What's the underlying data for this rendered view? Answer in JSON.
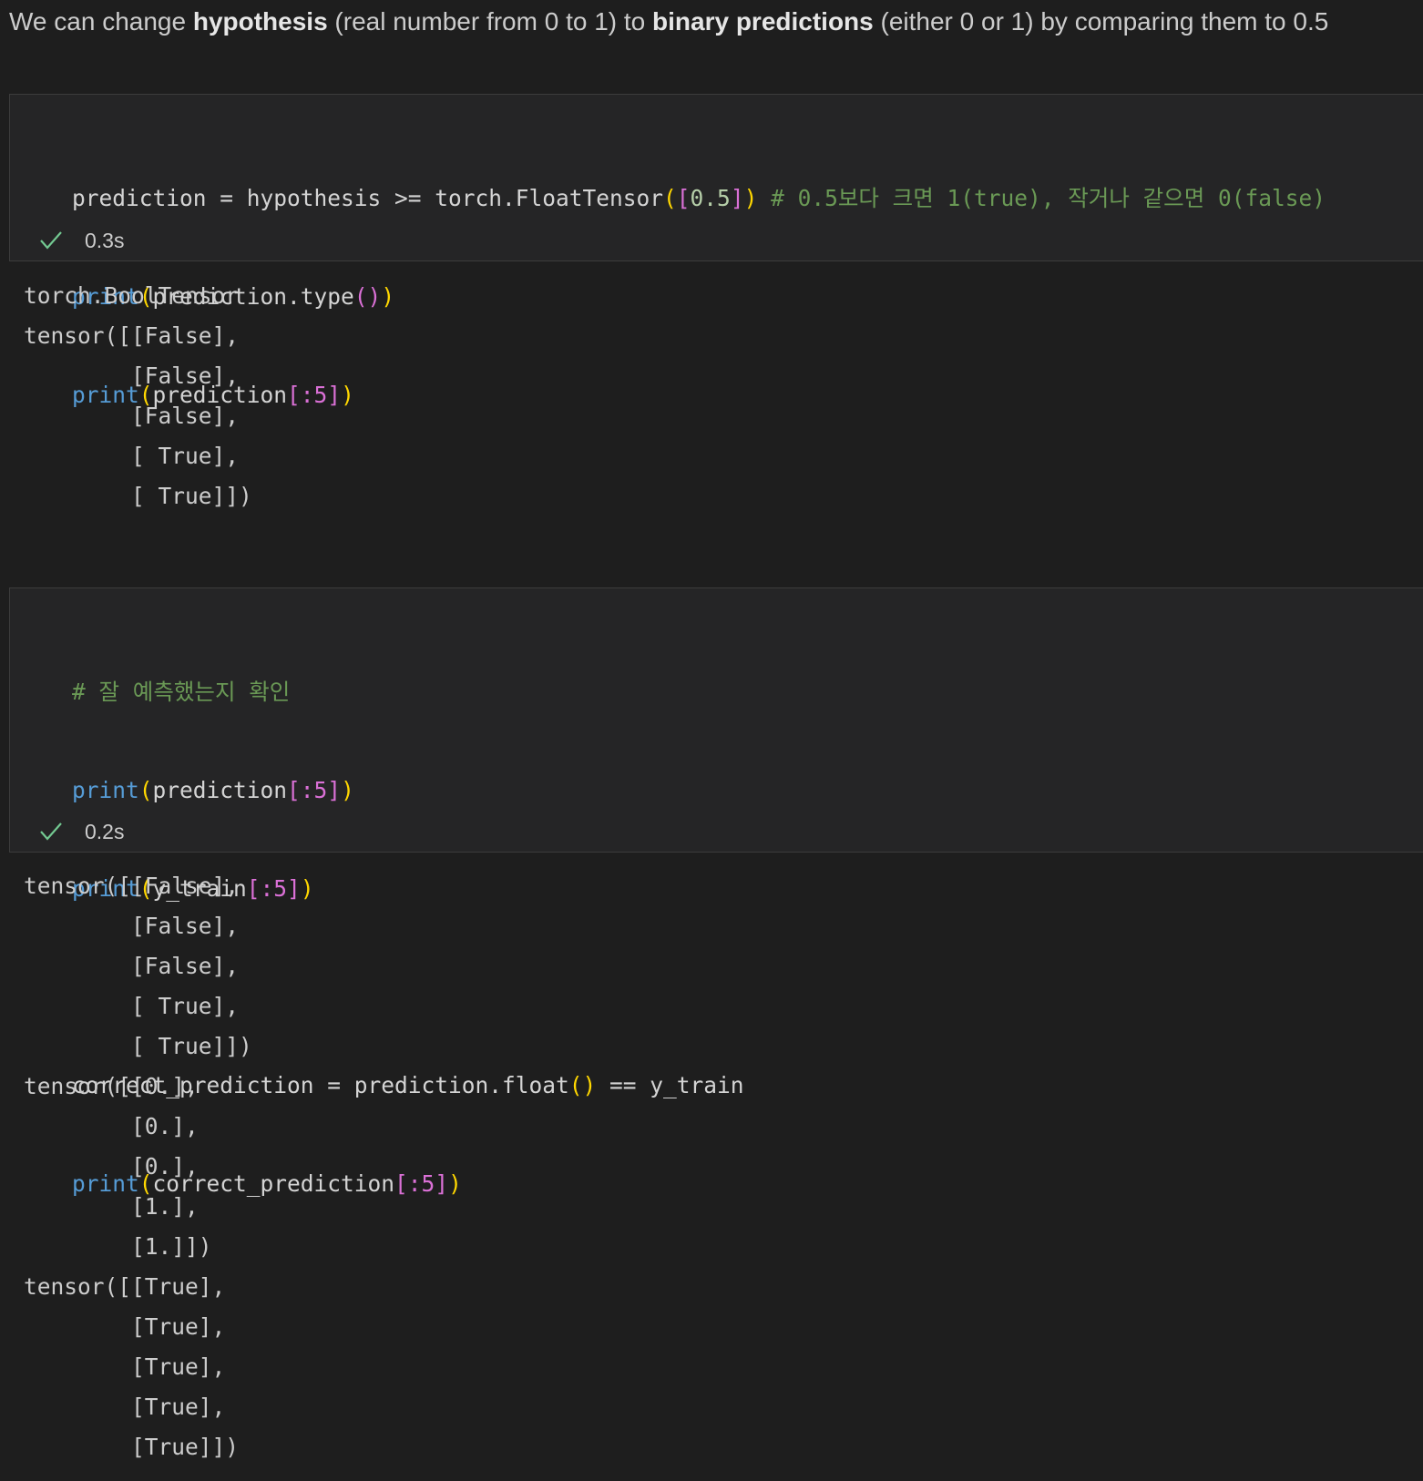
{
  "markdown": {
    "part1": "We can change ",
    "bold1": "hypothesis",
    "part2": " (real number from 0 to 1) to ",
    "bold2": "binary predictions",
    "part3": " (either 0 or 1) by comparing them to 0.5"
  },
  "cell1": {
    "line1": {
      "a": "prediction = hypothesis >= torch.FloatTensor",
      "p_open": "(",
      "b_open": "[",
      "num": "0.5",
      "b_close": "]",
      "p_close": ")",
      "comment": " # 0.5보다 크면 1(true), 작거나 같으면 0(false)"
    },
    "line2": {
      "fn": "print",
      "p_open": "(",
      "mid": "prediction.type",
      "inner": "()",
      "p_close": ")"
    },
    "line3": {
      "fn": "print",
      "p_open": "(",
      "mid": "prediction",
      "slice": "[:5]",
      "p_close": ")"
    },
    "exec_time": "0.3s"
  },
  "output1": [
    "torch.BoolTensor",
    "tensor([[False],",
    "        [False],",
    "        [False],",
    "        [ True],",
    "        [ True]])"
  ],
  "cell2": {
    "comment": "# 잘 예측했는지 확인",
    "line2": {
      "fn": "print",
      "p_open": "(",
      "mid": "prediction",
      "slice": "[:5]",
      "p_close": ")"
    },
    "line3": {
      "fn": "print",
      "p_open": "(",
      "mid": "y_train",
      "slice": "[:5]",
      "p_close": ")"
    },
    "line5": {
      "a": "correct_prediction = prediction.float",
      "inner": "()",
      "b": " == y_train"
    },
    "line6": {
      "fn": "print",
      "p_open": "(",
      "mid": "correct_prediction",
      "slice": "[:5]",
      "p_close": ")"
    },
    "exec_time": "0.2s"
  },
  "output2": [
    "tensor([[False],",
    "        [False],",
    "        [False],",
    "        [ True],",
    "        [ True]])",
    "tensor([[0.],",
    "        [0.],",
    "        [0.],",
    "        [1.],",
    "        [1.]])",
    "tensor([[True],",
    "        [True],",
    "        [True],",
    "        [True],",
    "        [True]])"
  ],
  "colors": {
    "background": "#1e1e1e",
    "cell_background": "#252526",
    "keyword_blue": "#569cd6",
    "bracket_gold": "#ffd700",
    "bracket_purple": "#da70d6",
    "comment_green": "#6a9955",
    "success_check": "#73c991"
  }
}
